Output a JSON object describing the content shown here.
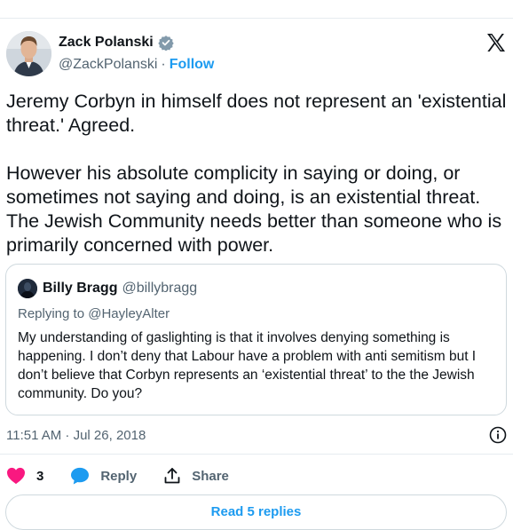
{
  "author": {
    "name": "Zack Polanski",
    "handle": "@ZackPolanski",
    "separator": "·",
    "follow_label": "Follow"
  },
  "icons": {
    "verified": "verified-badge-icon",
    "logo": "x-logo-icon",
    "info": "info-icon",
    "like": "heart-icon",
    "reply": "reply-bubble-icon",
    "share": "share-upload-icon"
  },
  "colors": {
    "accent": "#1d9bf0",
    "like": "#f91880",
    "secondary_text": "#536471",
    "border": "#cfd9de"
  },
  "tweet": {
    "text": "Jeremy Corbyn in himself does not represent an 'existential threat.' Agreed.\n\nHowever his absolute complicity in saying or doing, or sometimes not saying and doing, is an existential threat. The Jewish Community needs better than someone who is primarily concerned with power.",
    "timestamp": "11:51 AM · Jul 26, 2018"
  },
  "quoted_tweet": {
    "name": "Billy Bragg",
    "handle": "@billybragg",
    "replying_to": "Replying to @HayleyAlter",
    "text": "My understanding of gaslighting is that it involves denying something is happening. I don’t deny that Labour have a problem with anti semitism but I don’t believe that Corbyn represents an ‘existential threat’ to the the Jewish community. Do you?"
  },
  "actions": {
    "like_count": "3",
    "reply_label": "Reply",
    "share_label": "Share"
  },
  "read_replies_label": "Read 5 replies"
}
